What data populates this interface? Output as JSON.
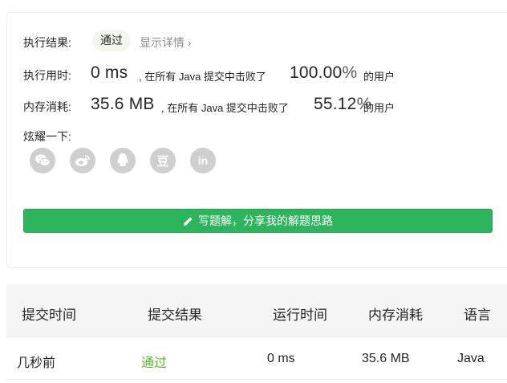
{
  "result": {
    "label": "执行结果:",
    "status": "通过",
    "detail_link": "显示详情 ›"
  },
  "runtime": {
    "label": "执行用时:",
    "value": "0 ms",
    "beat_text": ", 在所有 Java 提交中击败了",
    "percent": "100.00",
    "percent_sign": "%",
    "users": "的用户"
  },
  "memory": {
    "label": "内存消耗:",
    "value": "35.6 MB",
    "beat_text": ", 在所有 Java 提交中击败了",
    "percent": "55.12",
    "percent_sign": "%",
    "users": "的用户"
  },
  "share": {
    "label": "炫耀一下:",
    "icons": [
      "wechat-icon",
      "weibo-icon",
      "qq-icon",
      "douban-icon",
      "linkedin-icon"
    ],
    "douban_glyph": "豆",
    "linkedin_glyph": "in"
  },
  "write_button": {
    "label": "写题解，分享我的解题思路",
    "icon": "pencil-icon"
  },
  "table": {
    "headers": [
      "提交时间",
      "提交结果",
      "运行时间",
      "内存消耗",
      "语言"
    ],
    "rows": [
      [
        "几秒前",
        "通过",
        "0 ms",
        "35.6 MB",
        "Java"
      ]
    ]
  },
  "colors": {
    "accent_green": "#2db55d",
    "pass_green": "#5ab726",
    "icon_gray": "#cfcfcf"
  }
}
